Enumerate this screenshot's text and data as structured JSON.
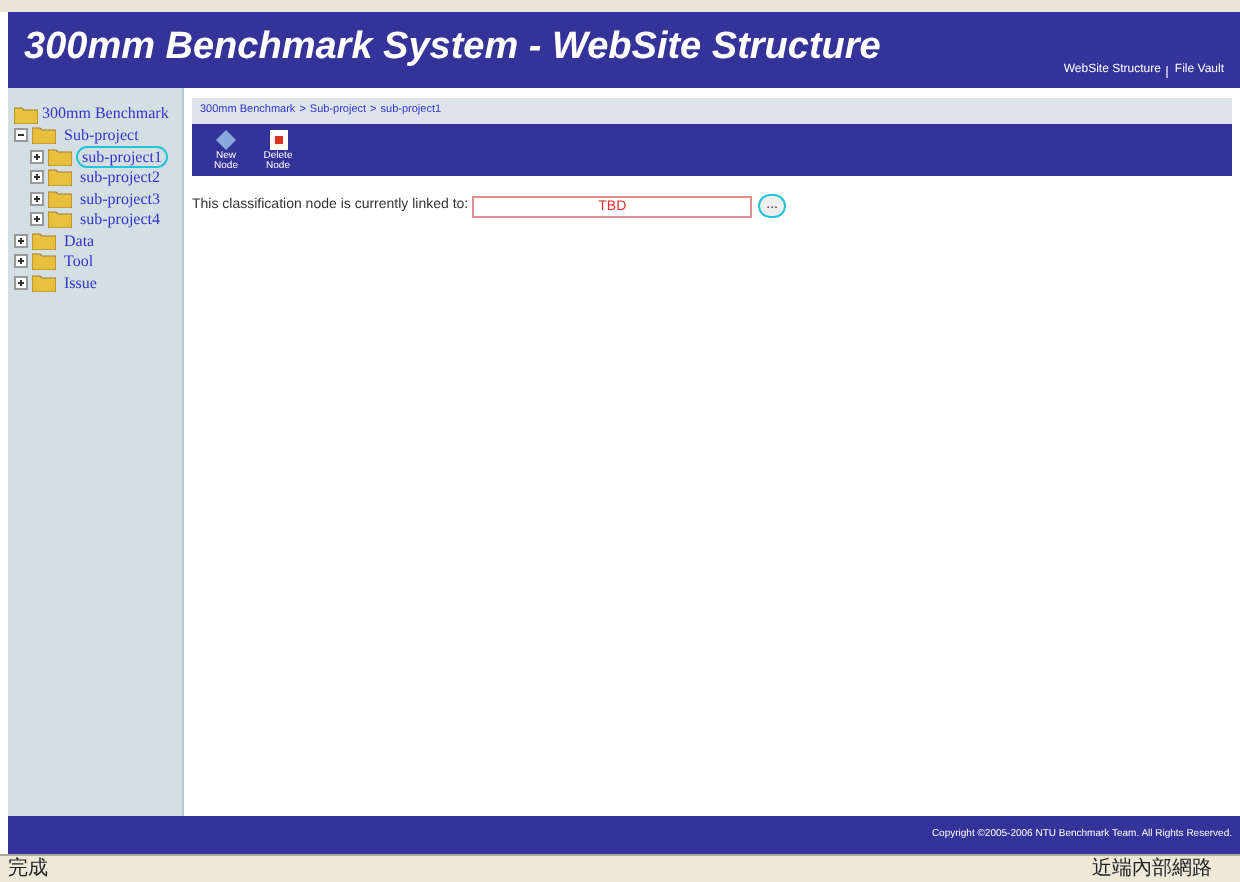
{
  "header": {
    "title": "300mm Benchmark System - WebSite Structure",
    "links": [
      "WebSite Structure",
      "File Vault"
    ]
  },
  "tree": {
    "label": "300mm Benchmark",
    "children": [
      {
        "label": "Sub-project",
        "expanded": true,
        "selected": false,
        "children": [
          {
            "label": "sub-project1",
            "expanded": false,
            "selected": true
          },
          {
            "label": "sub-project2",
            "expanded": false,
            "selected": false
          },
          {
            "label": "sub-project3",
            "expanded": false,
            "selected": false
          },
          {
            "label": "sub-project4",
            "expanded": false,
            "selected": false
          }
        ]
      },
      {
        "label": "Data",
        "expanded": false,
        "selected": false
      },
      {
        "label": "Tool",
        "expanded": false,
        "selected": false
      },
      {
        "label": "Issue",
        "expanded": false,
        "selected": false
      }
    ]
  },
  "breadcrumb": {
    "separator": ">",
    "items": [
      "300mm Benchmark",
      "Sub-project",
      "sub-project1"
    ]
  },
  "toolbar": [
    {
      "kind": "new",
      "label": "New Node"
    },
    {
      "kind": "delete",
      "label": "Delete Node"
    }
  ],
  "link_field": {
    "label": "This classification node is currently linked to:",
    "value": "TBD",
    "button": "..."
  },
  "footer": "Copyright ©2005-2006 NTU Benchmark Team. All Rights Reserved.",
  "status_bar": {
    "left": "完成",
    "right": "近端內部網路"
  }
}
